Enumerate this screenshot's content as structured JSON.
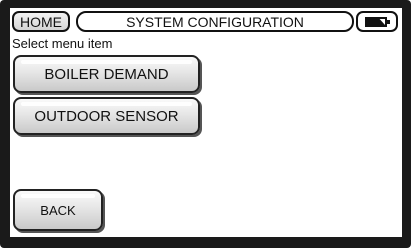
{
  "header": {
    "home_label": "HOME",
    "title": "SYSTEM CONFIGURATION",
    "battery_icon": "battery-icon"
  },
  "prompt": "Select menu item",
  "menu": {
    "items": [
      {
        "label": "BOILER DEMAND"
      },
      {
        "label": "OUTDOOR SENSOR"
      }
    ]
  },
  "footer": {
    "back_label": "BACK"
  },
  "colors": {
    "bezel": "#1a1a1a",
    "screen": "#ffffff",
    "button_top": "#fafafa",
    "button_bottom": "#c9c9c9",
    "outline": "#111111"
  }
}
